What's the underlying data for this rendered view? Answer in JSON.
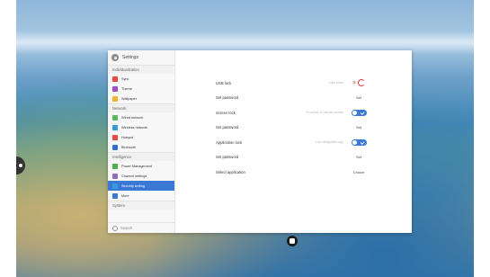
{
  "window": {
    "title": "Settings"
  },
  "sidebar": {
    "sections": [
      {
        "label": "Individualization",
        "items": [
          {
            "label": "Sync",
            "icon": "sync-icon",
            "color": "#e74c3c"
          },
          {
            "label": "Theme",
            "icon": "theme-icon",
            "color": "#9b4fc0"
          },
          {
            "label": "Wallpaper",
            "icon": "wallpaper-icon",
            "color": "#f0b429"
          }
        ]
      },
      {
        "label": "Network",
        "items": [
          {
            "label": "Wired network",
            "icon": "wired-network-icon",
            "color": "#5cb85c"
          },
          {
            "label": "Wireless network",
            "icon": "wireless-network-icon",
            "color": "#3a9ad9"
          },
          {
            "label": "Hotspot",
            "icon": "hotspot-icon",
            "color": "#e74c3c"
          },
          {
            "label": "Bluetooth",
            "icon": "bluetooth-icon",
            "color": "#2f6fd1"
          }
        ]
      },
      {
        "label": "Intelligence",
        "items": [
          {
            "label": "Power Management",
            "icon": "power-icon",
            "color": "#4caf50"
          },
          {
            "label": "Channel settings",
            "icon": "channel-icon",
            "color": "#8e6bbf"
          },
          {
            "label": "Security setting",
            "icon": "security-icon",
            "color": "#3a9ad9",
            "active": true
          },
          {
            "label": "More",
            "icon": "more-icon",
            "color": "#3a78d6"
          }
        ]
      },
      {
        "label": "System",
        "items": []
      }
    ],
    "search": {
      "placeholder": "Search"
    }
  },
  "security": {
    "usb_lock": {
      "label": "USB lock",
      "hint": "Lock when",
      "state": "off"
    },
    "usb_password": {
      "label": "Set password",
      "action": "Set"
    },
    "screen_lock": {
      "label": "Screen lock",
      "hint": "To unlock or lock the screen",
      "state": "on"
    },
    "screen_password": {
      "label": "Set password",
      "action": "Set"
    },
    "app_lock": {
      "label": "Application lock",
      "hint": "Lock designated app",
      "state": "on"
    },
    "app_password": {
      "label": "Set password",
      "action": "Set"
    },
    "select_app": {
      "label": "Select application",
      "action": "Choice"
    }
  },
  "colors": {
    "accent": "#3a78d6",
    "off": "#e23b3b"
  }
}
